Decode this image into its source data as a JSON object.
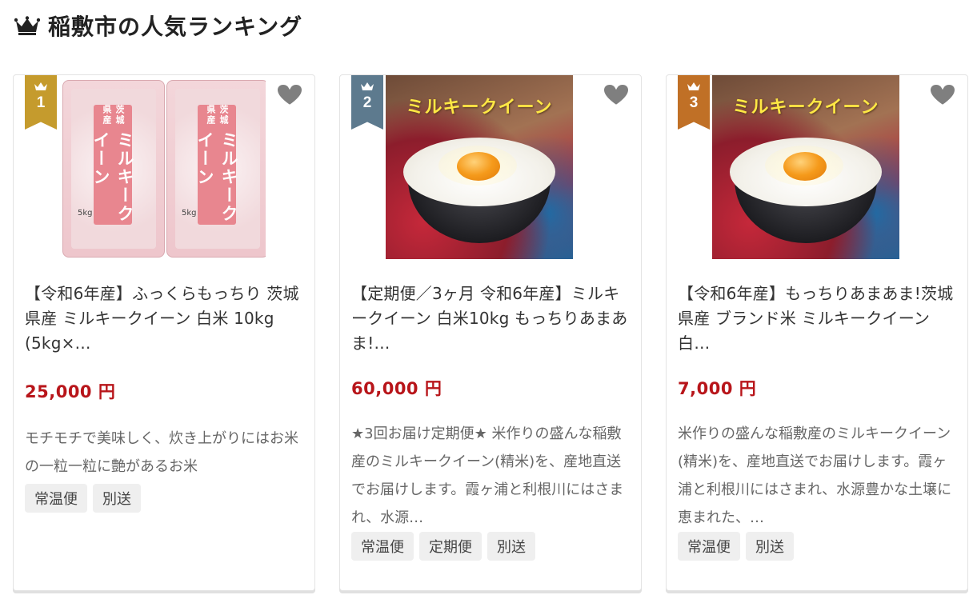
{
  "section": {
    "title": "稲敷市の人気ランキング"
  },
  "cards": [
    {
      "rank": "1",
      "title": "【令和6年産】ふっくらもっちり 茨城県産 ミルキークイーン 白米 10kg (5kg×…",
      "price": "25,000 円",
      "description": "モチモチで美味しく、炊き上がりにはお米の一粒一粒に艶があるお米",
      "tags": [
        "常温便",
        "別送"
      ],
      "image": {
        "label_small": "茨城県産",
        "label": "ミルキークイーン",
        "kg": "5kg"
      }
    },
    {
      "rank": "2",
      "title": "【定期便／3ヶ月 令和6年産】ミルキークイーン 白米10kg もっちりあまあま!…",
      "price": "60,000 円",
      "description": "★3回お届け定期便★ 米作りの盛んな稲敷産のミルキークイーン(精米)を、産地直送でお届けします。霞ヶ浦と利根川にはさまれ、水源…",
      "tags": [
        "常温便",
        "定期便",
        "別送"
      ],
      "image": {
        "caption": "ミルキークイーン"
      }
    },
    {
      "rank": "3",
      "title": "【令和6年産】もっちりあまあま!茨城県産 ブランド米 ミルキークイーン 白…",
      "price": "7,000 円",
      "description": "米作りの盛んな稲敷産のミルキークイーン(精米)を、産地直送でお届けします。霞ヶ浦と利根川にはさまれ、水源豊かな土壌に恵まれた、…",
      "tags": [
        "常温便",
        "別送"
      ],
      "image": {
        "caption": "ミルキークイーン"
      }
    }
  ],
  "colors": {
    "rank_1": "#c59b2d",
    "rank_2": "#5d7a8e",
    "rank_3": "#c07026",
    "price": "#b8151a",
    "favorite_icon": "#7f7f7f"
  },
  "icons": {
    "section": "crown-icon",
    "rank": "crown-icon",
    "favorite": "heart-icon"
  }
}
